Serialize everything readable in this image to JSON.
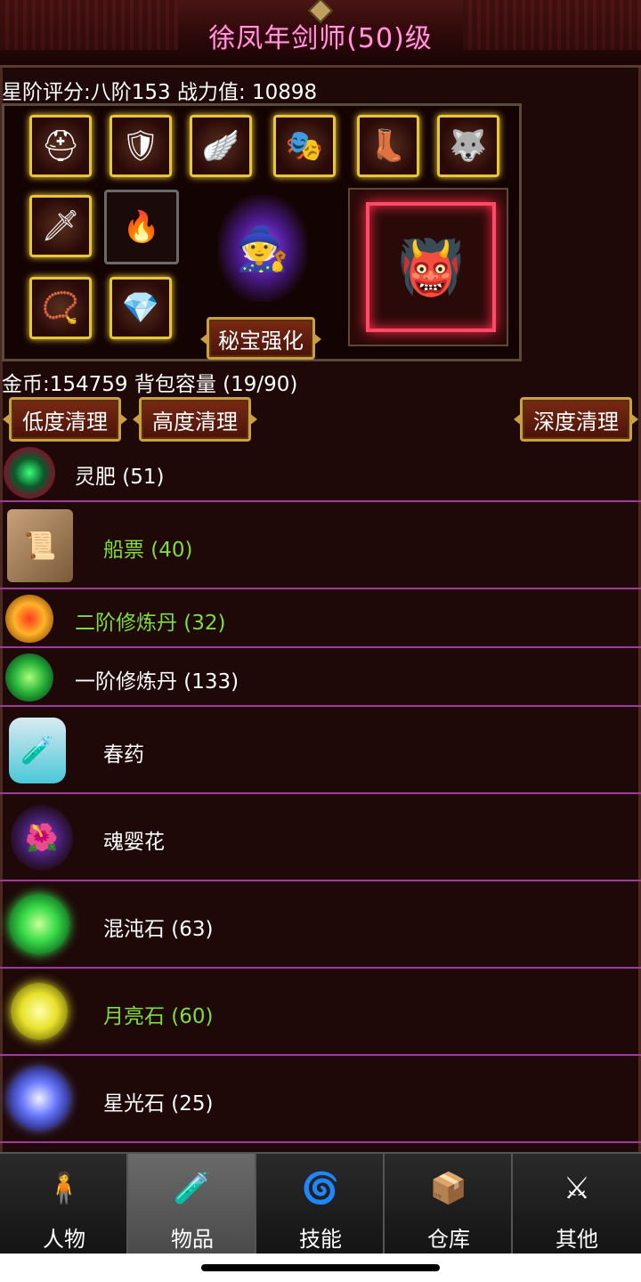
{
  "header": {
    "title": "徐凤年剑师(50)级"
  },
  "stats": {
    "rating_line": "星阶评分:八阶153 战力值: 10898",
    "gold_line": "金币:154759 背包容量 (19/90)"
  },
  "equipment": {
    "slots": [
      {
        "icon": "helmet-icon"
      },
      {
        "icon": "armor-icon"
      },
      {
        "icon": "wing-icon"
      },
      {
        "icon": "shoulder-icon"
      },
      {
        "icon": "boots-icon"
      },
      {
        "icon": "beast-mask-icon"
      },
      {
        "icon": "dagger-icon"
      },
      {
        "icon": "flame-sword-icon"
      },
      {
        "icon": "necklace-icon"
      },
      {
        "icon": "belt-icon"
      }
    ],
    "enhance_button": "秘宝强化"
  },
  "cleanup": {
    "low": "低度清理",
    "high": "高度清理",
    "deep": "深度清理"
  },
  "items": [
    {
      "name": "灵肥 (51)",
      "color": "#ffffff",
      "icon": "spirit-fertilizer-icon"
    },
    {
      "name": "船票 (40)",
      "color": "#7fdc3a",
      "icon": "scroll-icon"
    },
    {
      "name": "二阶修炼丹 (32)",
      "color": "#7fdc3a",
      "icon": "gold-pill-icon"
    },
    {
      "name": "一阶修炼丹 (133)",
      "color": "#ffffff",
      "icon": "green-pill-icon"
    },
    {
      "name": "春药",
      "color": "#ffffff",
      "icon": "potion-bottle-icon"
    },
    {
      "name": "魂婴花",
      "color": "#ffffff",
      "icon": "soul-flower-icon"
    },
    {
      "name": "混沌石 (63)",
      "color": "#ffffff",
      "icon": "chaos-stone-icon"
    },
    {
      "name": "月亮石 (60)",
      "color": "#7fdc3a",
      "icon": "moon-stone-icon"
    },
    {
      "name": "星光石 (25)",
      "color": "#ffffff",
      "icon": "star-stone-icon"
    }
  ],
  "nav": {
    "tabs": [
      {
        "label": "人物",
        "icon": "character-icon",
        "active": false
      },
      {
        "label": "物品",
        "icon": "items-icon",
        "active": true
      },
      {
        "label": "技能",
        "icon": "skill-icon",
        "active": false
      },
      {
        "label": "仓库",
        "icon": "warehouse-icon",
        "active": false
      },
      {
        "label": "其他",
        "icon": "other-icon",
        "active": false
      }
    ]
  }
}
